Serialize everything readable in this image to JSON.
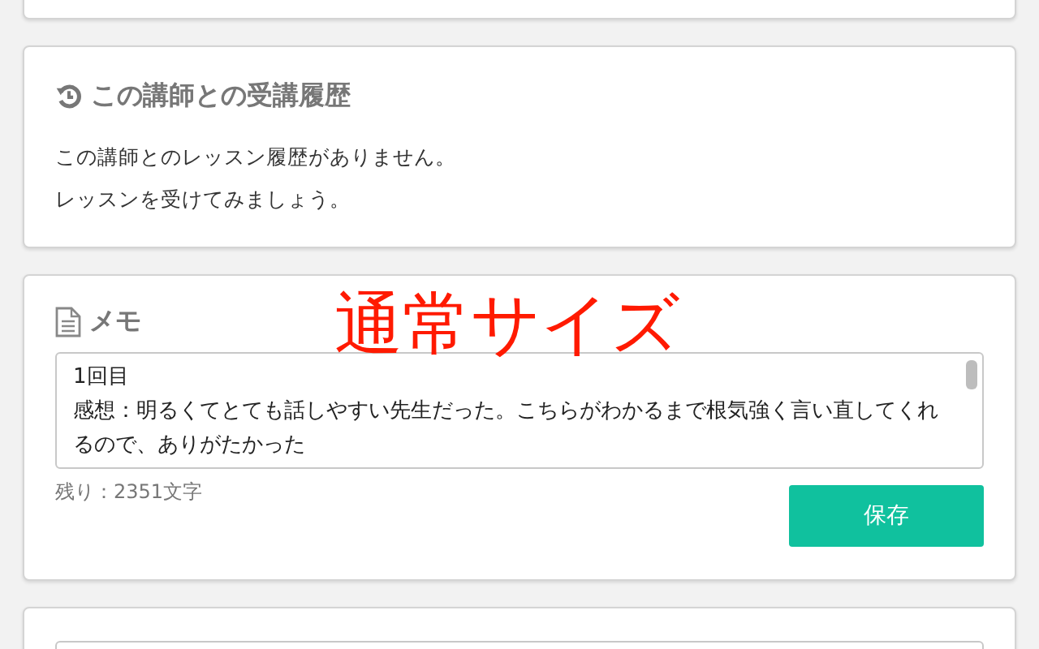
{
  "history": {
    "title": "この講師との受講履歴",
    "lines": [
      "この講師とのレッスン履歴がありません。",
      "レッスンを受けてみましょう。"
    ]
  },
  "memo": {
    "title": "メモ",
    "lines": [
      "1回目",
      "感想：明るくてとても話しやすい先生だった。こちらがわかるまで根気強く言い直してくれるので、ありがたかった"
    ],
    "remaining": "残り：2351文字",
    "save_button": "保存"
  },
  "annotation": "通常サイズ"
}
